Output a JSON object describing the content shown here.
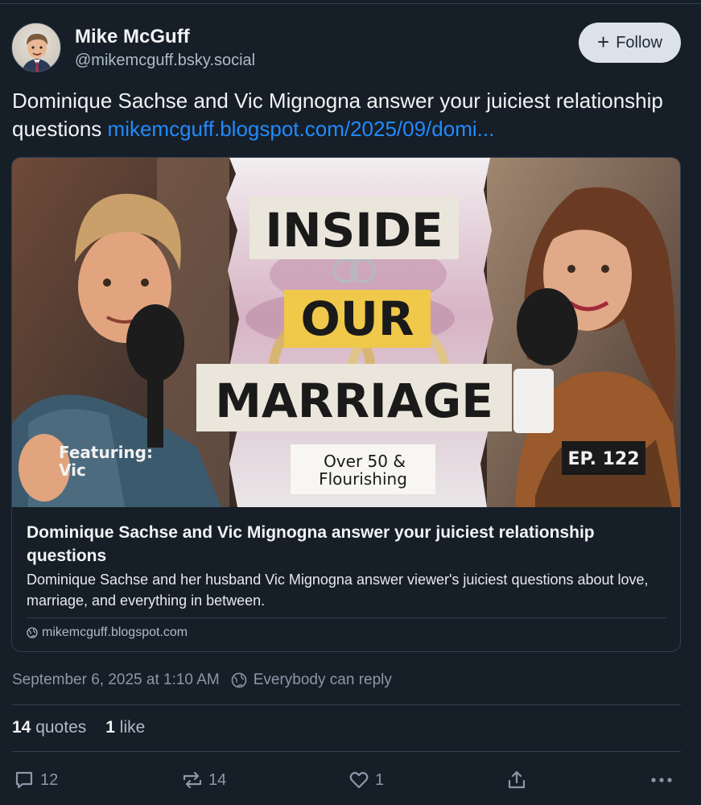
{
  "author": {
    "display_name": "Mike McGuff",
    "handle": "@mikemcguff.bsky.social",
    "follow_label": "Follow"
  },
  "post": {
    "text": "Dominique Sachse and Vic Mignogna answer your juiciest relationship questions ",
    "link_text": "mikemcguff.blogspot.com/2025/09/domi..."
  },
  "card": {
    "thumbnail": {
      "title_line1": "INSIDE",
      "title_line2": "OUR",
      "title_line3": "MARRIAGE",
      "sub_line1": "Over 50 &",
      "sub_line2": "Flourishing",
      "featuring_line1": "Featuring:",
      "featuring_line2": "Vic",
      "episode": "EP. 122"
    },
    "title": "Dominique Sachse and Vic Mignogna answer your juiciest relationship questions",
    "description": "Dominique Sachse and her husband Vic Mignogna answer viewer's juiciest questions about love, marriage, and everything in between.",
    "domain": "mikemcguff.blogspot.com",
    "domain_icon": "globe-icon"
  },
  "meta": {
    "timestamp": "September 6, 2025 at 1:10 AM",
    "reply_setting": "Everybody can reply",
    "reply_icon": "globe-icon"
  },
  "stats": {
    "quotes_count": "14",
    "quotes_label": "quotes",
    "likes_count": "1",
    "likes_label": "like"
  },
  "actions": {
    "reply_count": "12",
    "repost_count": "14",
    "like_count": "1",
    "reply_icon": "comment-icon",
    "repost_icon": "repost-icon",
    "like_icon": "heart-icon",
    "share_icon": "share-icon",
    "more_icon": "more-dots-icon"
  },
  "colors": {
    "background": "#161e27",
    "link": "#208bfe",
    "muted": "#8a99a9",
    "follow_button_bg": "#dce2ea"
  }
}
